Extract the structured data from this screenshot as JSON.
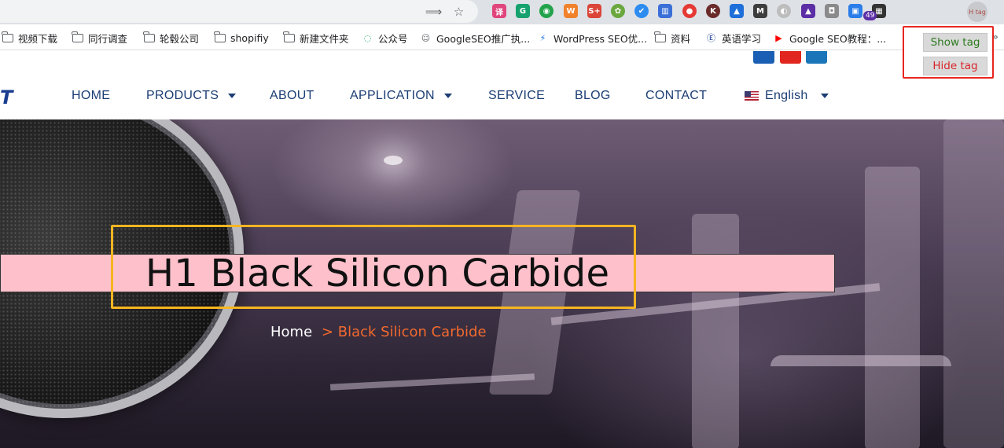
{
  "browser": {
    "toolbar_icons": [
      "translate-icon",
      "star-icon"
    ],
    "extensions": [
      {
        "name": "translate-ext-icon",
        "glyph": "译",
        "color": "#e0457b"
      },
      {
        "name": "grammarly-icon",
        "glyph": "G",
        "color": "#15a26e"
      },
      {
        "name": "green-robot-icon",
        "glyph": "◉",
        "color": "#22a34b"
      },
      {
        "name": "wordpress-ext-icon",
        "glyph": "W",
        "color": "#f1822b"
      },
      {
        "name": "sheets-plus-icon",
        "glyph": "S+",
        "color": "#db4437"
      },
      {
        "name": "sprout-icon",
        "glyph": "✿",
        "color": "#6aa83f"
      },
      {
        "name": "check-shield-icon",
        "glyph": "✔",
        "color": "#2d8cf0"
      },
      {
        "name": "bar-chart-icon",
        "glyph": "▥",
        "color": "#3b6fd8"
      },
      {
        "name": "pokeball-icon",
        "glyph": "●",
        "color": "#e53935"
      },
      {
        "name": "k-icon",
        "glyph": "K",
        "color": "#6b2a2a"
      },
      {
        "name": "mountain-icon",
        "glyph": "▲",
        "color": "#1e6fd9"
      },
      {
        "name": "m-icon",
        "glyph": "M",
        "color": "#3d3d3d"
      },
      {
        "name": "moon-icon",
        "glyph": "◐",
        "color": "#bdbdbd"
      },
      {
        "name": "graduation-cap-icon",
        "glyph": "▲",
        "color": "#5b2ea6"
      },
      {
        "name": "camera-icon",
        "glyph": "◘",
        "color": "#8a8a8a"
      },
      {
        "name": "window-ext-icon",
        "glyph": "▣",
        "color": "#2b7de9"
      },
      {
        "name": "qr-code-icon",
        "glyph": "▦",
        "color": "#333333"
      }
    ],
    "extension_badge": "49",
    "avatar_text": "H tag",
    "bookmarks": [
      {
        "icon": "folder-icon",
        "label": "视频下载"
      },
      {
        "icon": "folder-icon",
        "label": "同行调查"
      },
      {
        "icon": "folder-icon",
        "label": "轮毂公司"
      },
      {
        "icon": "folder-icon",
        "label": "shopifiy"
      },
      {
        "icon": "folder-icon",
        "label": "新建文件夹"
      },
      {
        "icon": "wechat-icon",
        "label": "公众号"
      },
      {
        "icon": "owl-icon",
        "label": "GoogleSEO推广执..."
      },
      {
        "icon": "bolt-icon",
        "label": "WordPress SEO优..."
      },
      {
        "icon": "folder-icon",
        "label": "资料"
      },
      {
        "icon": "e-circle-icon",
        "label": "英语学习"
      },
      {
        "icon": "youtube-icon",
        "label": "Google SEO教程：..."
      }
    ],
    "bookmarks_more": "»"
  },
  "site": {
    "logo_fragment": "T",
    "nav": [
      {
        "label": "HOME",
        "dropdown": false
      },
      {
        "label": "PRODUCTS",
        "dropdown": true
      },
      {
        "label": "ABOUT",
        "dropdown": false
      },
      {
        "label": "APPLICATION",
        "dropdown": true
      },
      {
        "label": "SERVICE",
        "dropdown": false
      },
      {
        "label": "BLOG",
        "dropdown": false
      },
      {
        "label": "CONTACT",
        "dropdown": false
      }
    ],
    "language": "English",
    "social_colors": [
      "#1a5fb4",
      "#e0261e",
      "#1a76b8"
    ]
  },
  "hero": {
    "title": "H1 Black Silicon Carbide",
    "breadcrumb": {
      "home": "Home",
      "separator": ">",
      "current": "Black Silicon Carbide"
    }
  },
  "popup": {
    "show_label": "Show tag",
    "hide_label": "Hide tag"
  },
  "colors": {
    "nav_text": "#1b3d74",
    "title_highlight": "#fec0cb",
    "title_outline": "#f7b521",
    "breadcrumb_accent": "#f26a2e",
    "popup_border": "#e8261f"
  }
}
